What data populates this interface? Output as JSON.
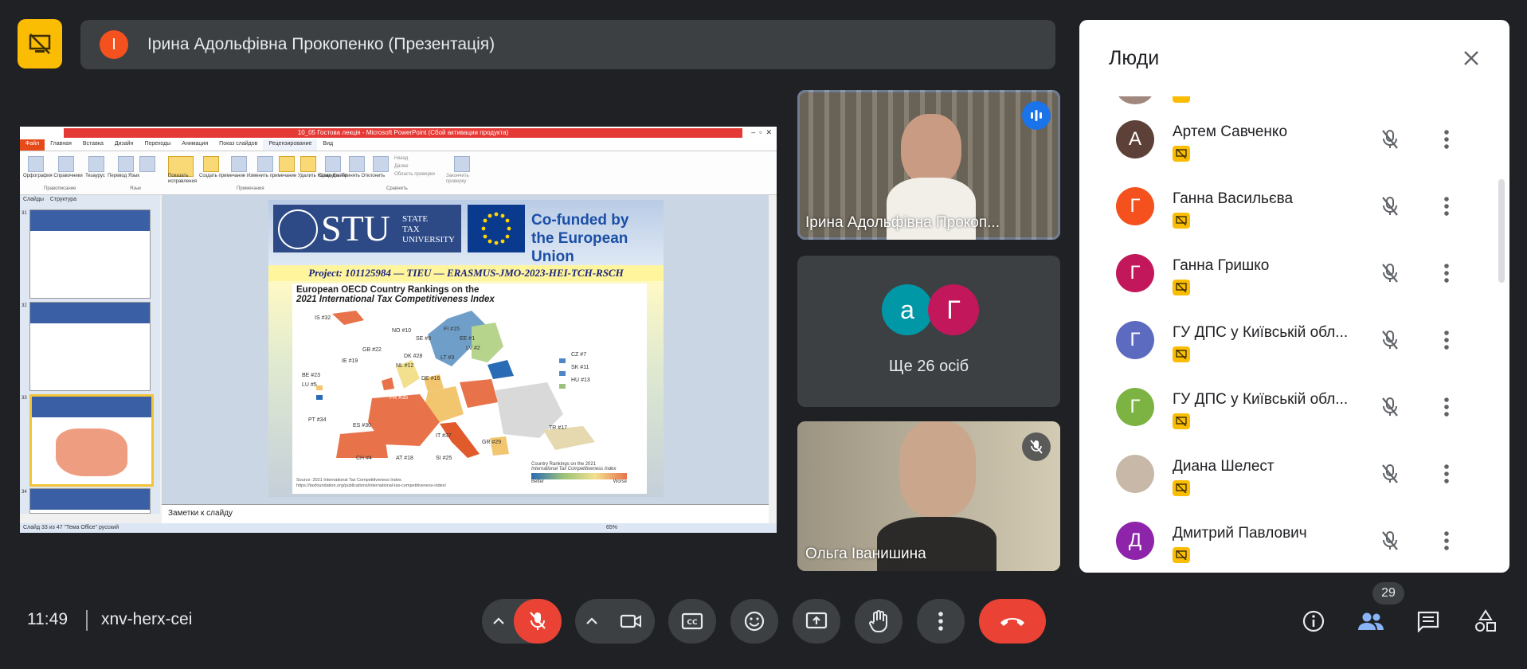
{
  "topbar": {
    "presenter_initial": "І",
    "presenter_title": "Ірина Адольфівна Прокопенко (Презентація)"
  },
  "powerpoint": {
    "window_title": "10_05 Гостова лекція - Microsoft PowerPoint (Сбой активации продукта)",
    "menu": [
      "Файл",
      "Главная",
      "Вставка",
      "Дизайн",
      "Переходы",
      "Анимация",
      "Показ слайдов",
      "Рецензирование",
      "Вид"
    ],
    "ribbon_labels": [
      "Орфография",
      "Справочники",
      "Тезаурус",
      "Перевод",
      "Язык",
      "Показать исправления",
      "Создать примечание",
      "Изменить примечание",
      "Удалить",
      "Назад",
      "Далее",
      "Сравнить",
      "Принять",
      "Отклонить",
      "Назад",
      "Далее",
      "Область проверки",
      "Закончить проверку"
    ],
    "ribbon_groups": [
      "Правописание",
      "Язык",
      "Примечания",
      "Сравнить"
    ],
    "side_tabs": [
      "Слайды",
      "Структура"
    ],
    "slide_numbers": [
      "31",
      "32",
      "33",
      "34"
    ],
    "notes_placeholder": "Заметки к слайду",
    "status_text": "Слайд 33 из 47   \"Тема Office\"   русский",
    "zoom": "65%"
  },
  "slide": {
    "stu_big": "STU",
    "stu_small_1": "STATE",
    "stu_small_2": "TAX",
    "stu_small_3": "UNIVERSITY",
    "eu_line1": "Co-funded by",
    "eu_line2": "the European Union",
    "project": "Project: 101125984 — TIEU — ERASMUS-JMO-2023-HEI-TCH-RSCH",
    "map_title_1": "European OECD Country Rankings on the",
    "map_title_2": "2021 International Tax Competitiveness Index",
    "legend_title_1": "Country Rankings on the 2021",
    "legend_title_2": "International Tax Competitiveness Index",
    "legend_better": "Better",
    "legend_worse": "Worse",
    "source_1": "Source: 2021 International Tax Competitiveness Index.",
    "source_2": "https://taxfoundation.org/publications/international-tax-competitiveness-index/",
    "country_labels": [
      {
        "code": "IS",
        "rank": "#32"
      },
      {
        "code": "NO",
        "rank": "#10"
      },
      {
        "code": "SE",
        "rank": "#9"
      },
      {
        "code": "FI",
        "rank": "#15"
      },
      {
        "code": "EE",
        "rank": "#1"
      },
      {
        "code": "LV",
        "rank": "#2"
      },
      {
        "code": "LT",
        "rank": "#3"
      },
      {
        "code": "GB",
        "rank": "#22"
      },
      {
        "code": "IE",
        "rank": "#19"
      },
      {
        "code": "DK",
        "rank": "#28"
      },
      {
        "code": "NL",
        "rank": "#12"
      },
      {
        "code": "BE",
        "rank": "#23"
      },
      {
        "code": "LU",
        "rank": "#5"
      },
      {
        "code": "DE",
        "rank": "#16"
      },
      {
        "code": "PL",
        "rank": "#36"
      },
      {
        "code": "CZ",
        "rank": "#7"
      },
      {
        "code": "SK",
        "rank": "#11"
      },
      {
        "code": "HU",
        "rank": "#13"
      },
      {
        "code": "FR",
        "rank": "#35"
      },
      {
        "code": "PT",
        "rank": "#34"
      },
      {
        "code": "ES",
        "rank": "#30"
      },
      {
        "code": "IT",
        "rank": "#37"
      },
      {
        "code": "GR",
        "rank": "#29"
      },
      {
        "code": "TR",
        "rank": "#17"
      },
      {
        "code": "CH",
        "rank": "#4"
      },
      {
        "code": "AT",
        "rank": "#18"
      },
      {
        "code": "SI",
        "rank": "#25"
      }
    ]
  },
  "tiles": [
    {
      "name": "Ірина Адольфівна Прокоп..."
    },
    {
      "avatar_1": "а",
      "avatar_2": "Г",
      "label": "Ще 26 осіб"
    },
    {
      "name": "Ольга Іванишина"
    }
  ],
  "people": {
    "title": "Люди",
    "list": [
      {
        "initial": "А",
        "name": "Артем Савченко",
        "color": "#5d4037"
      },
      {
        "initial": "Г",
        "name": "Ганна Васильєва",
        "color": "#f4511e"
      },
      {
        "initial": "Г",
        "name": "Ганна Гришко",
        "color": "#c2185b"
      },
      {
        "initial": "Г",
        "name": "ГУ ДПС у Київській обл...",
        "color": "#5c6bc0"
      },
      {
        "initial": "Г",
        "name": "ГУ ДПС у Київській обл...",
        "color": "#7cb342"
      },
      {
        "initial": "",
        "name": "Диана Шелест",
        "color": "#c8b8a8"
      },
      {
        "initial": "Д",
        "name": "Дмитрий Павлович",
        "color": "#8e24aa"
      }
    ]
  },
  "bottombar": {
    "time": "11:49",
    "meeting_code": "xnv-herx-cei",
    "participants_count": "29"
  },
  "colors": {
    "background": "#202124",
    "surface": "#3c4043",
    "accent_blue": "#8ab4f8",
    "danger": "#ea4335",
    "present_yellow": "#fbbc04"
  }
}
